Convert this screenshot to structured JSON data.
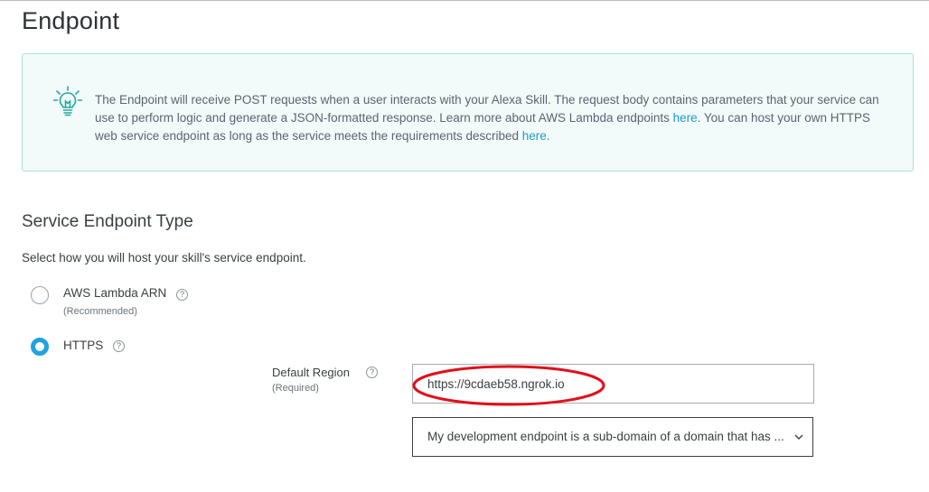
{
  "page": {
    "title": "Endpoint"
  },
  "info": {
    "icon": "lightbulb-icon",
    "text_1": "The Endpoint will receive POST requests when a user interacts with your Alexa Skill. The request body contains parameters that your service can use to perform logic and generate a JSON-formatted response. Learn more about AWS Lambda endpoints ",
    "link_1": "here",
    "text_2": ". You can host your own HTTPS web service endpoint as long as the service meets the requirements described ",
    "link_2": "here.",
    "accent_color": "#a9e3dc",
    "link_color": "#1e9ad0"
  },
  "service_endpoint": {
    "title": "Service Endpoint Type",
    "description": "Select how you will host your skill's service endpoint.",
    "options": [
      {
        "label": "AWS Lambda ARN",
        "sublabel": "(Recommended)",
        "selected": false,
        "help": "?"
      },
      {
        "label": "HTTPS",
        "selected": true,
        "help": "?"
      }
    ],
    "selected_color": "#1fa3dd"
  },
  "default_region": {
    "label": "Default Region",
    "sublabel": "(Required)",
    "help": "?",
    "url_value": "https://9cdaeb58.ngrok.io",
    "certificate_selected": "My development endpoint is a sub-domain of a domain that has ...",
    "annotation_color": "#e0101a"
  }
}
